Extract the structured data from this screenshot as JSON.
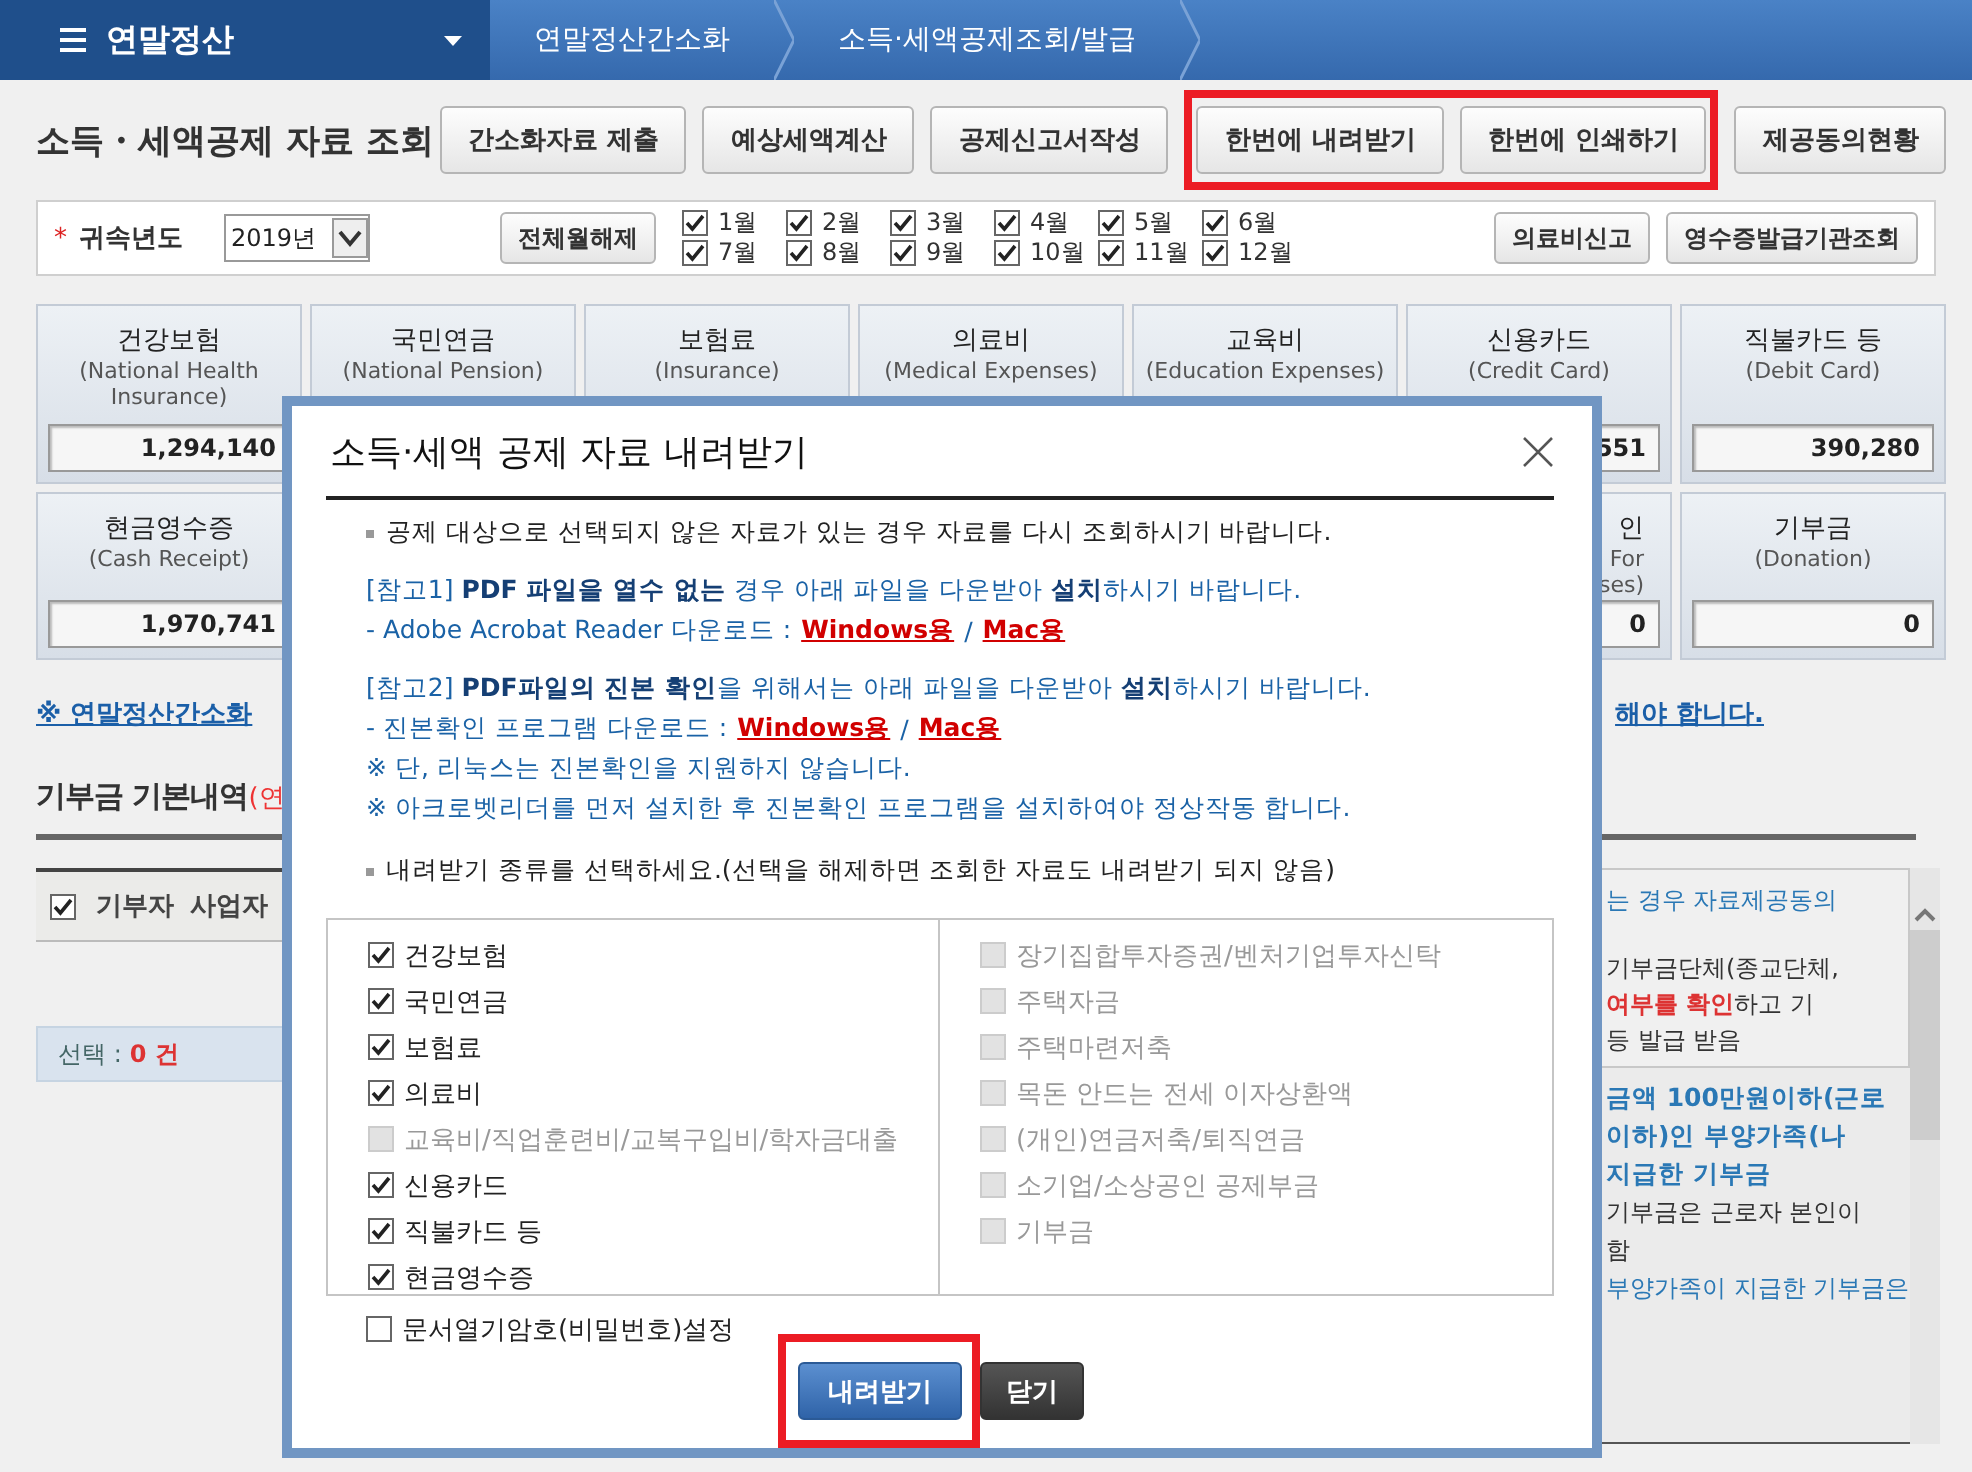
{
  "nav": {
    "menu_title": "연말정산",
    "breadcrumbs": [
      "연말정산간소화",
      "소득·세액공제조회/발급"
    ]
  },
  "page_title": "소득・세액공제 자료 조회",
  "toolbar": [
    {
      "label": "간소화자료 제출",
      "highlighted": false
    },
    {
      "label": "예상세액계산",
      "highlighted": false
    },
    {
      "label": "공제신고서작성",
      "highlighted": false
    },
    {
      "label": "한번에 내려받기",
      "highlighted": true
    },
    {
      "label": "한번에 인쇄하기",
      "highlighted": true
    },
    {
      "label": "제공동의현황",
      "highlighted": false
    }
  ],
  "filter": {
    "required_mark": "*",
    "year_label": "귀속년도",
    "year": "2019년",
    "toggle_all": "전체월해제",
    "months": [
      {
        "label": "1월",
        "checked": true
      },
      {
        "label": "2월",
        "checked": true
      },
      {
        "label": "3월",
        "checked": true
      },
      {
        "label": "4월",
        "checked": true
      },
      {
        "label": "5월",
        "checked": true
      },
      {
        "label": "6월",
        "checked": true
      },
      {
        "label": "7월",
        "checked": true
      },
      {
        "label": "8월",
        "checked": true
      },
      {
        "label": "9월",
        "checked": true
      },
      {
        "label": "10월",
        "checked": true
      },
      {
        "label": "11월",
        "checked": true
      },
      {
        "label": "12월",
        "checked": true
      }
    ],
    "buttons": [
      "의료비신고",
      "영수증발급기관조회"
    ]
  },
  "cards_row1": [
    {
      "title": "건강보험",
      "subtitle_lines": [
        "(National Health",
        "Insurance)"
      ],
      "value": "1,294,140"
    },
    {
      "title": "국민연금",
      "subtitle_lines": [
        "(National Pension)"
      ]
    },
    {
      "title": "보험료",
      "subtitle_lines": [
        "(Insurance)"
      ]
    },
    {
      "title": "의료비",
      "subtitle_lines": [
        "(Medical Expenses)"
      ]
    },
    {
      "title": "교육비",
      "subtitle_lines": [
        "(Education Expenses)"
      ]
    },
    {
      "title": "신용카드",
      "subtitle_lines": [
        "(Credit Card)"
      ],
      "value": "551"
    },
    {
      "title": "직불카드 등",
      "subtitle_lines": [
        "(Debit Card)"
      ],
      "value": "390,280"
    }
  ],
  "cards_row2": {
    "left": [
      {
        "title": "현금영수증",
        "subtitle_lines": [
          "(Cash Receipt)"
        ],
        "value": "1,970,741"
      }
    ],
    "right": [
      {
        "title": "인",
        "subtitle_lines": [
          "For",
          "ses)"
        ],
        "value": "0"
      },
      {
        "title": "기부금",
        "subtitle_lines": [
          "(Donation)"
        ],
        "value": "0"
      }
    ]
  },
  "notice": {
    "left": "※ 연말정산간소화",
    "right": "해야 합니다."
  },
  "donation": {
    "title": "기부금 기본내역",
    "title_note": "(연",
    "header_checked": true,
    "columns": [
      "기부자",
      "사업자"
    ],
    "selection_label": "선택 :",
    "selection_count": "0 건"
  },
  "info_panel": {
    "box_lines": [
      {
        "kind": "blue",
        "text": "는 경우 자료제공동의"
      },
      {
        "kind": "plain",
        "text": "기부금단체(종교단체,"
      },
      {
        "kind": "plain",
        "text": "**여부를 확인**하고 기"
      },
      {
        "kind": "plain",
        "text": "등 발급 받음"
      }
    ],
    "lines": [
      {
        "kind": "heading",
        "text": "금액 100만원이하(근로"
      },
      {
        "kind": "heading",
        "text": "이하)인 부양가족(나"
      },
      {
        "kind": "heading",
        "text": "지급한 기부금"
      },
      {
        "kind": "plain",
        "text": "기부금은 근로자 본인이"
      },
      {
        "kind": "plain",
        "text": "함"
      },
      {
        "kind": "blue",
        "text": "부양가족이 지급한 기부금은"
      }
    ]
  },
  "dialog": {
    "title": "소득·세액 공제 자료 내려받기",
    "intro": "공제 대상으로 선택되지 않은 자료가 있는 경우 자료를 다시 조회하시기 바랍니다.",
    "references": [
      {
        "text": "[참고1] **PDF 파일을 열수 없는** 경우  아래 파일을 다운받아 **설치**하시기 바랍니다.",
        "download_label": "- Adobe Acrobat Reader 다운로드 :",
        "links": [
          "Windows용",
          "Mac용"
        ],
        "separator": "/"
      },
      {
        "text": "[참고2] **PDF파일의 진본 확인**을 위해서는 아래 파일을 다운받아 **설치**하시기 바랍니다.",
        "download_label": "- 진본확인 프로그램 다운로드 :",
        "links": [
          "Windows용",
          "Mac용"
        ],
        "separator": "/",
        "notes": [
          "※ 단, 리눅스는 진본확인을 지원하지 않습니다.",
          "※ 아크로벳리더를 먼저 설치한 후 진본확인 프로그램을 설치하여야 정상작동 합니다."
        ]
      }
    ],
    "select_prompt": "내려받기 종류를 선택하세요.(선택을 해제하면 조회한 자료도 내려받기 되지 않음)",
    "left_options": [
      {
        "label": "건강보험",
        "checked": true,
        "disabled": false
      },
      {
        "label": "국민연금",
        "checked": true,
        "disabled": false
      },
      {
        "label": "보험료",
        "checked": true,
        "disabled": false
      },
      {
        "label": "의료비",
        "checked": true,
        "disabled": false
      },
      {
        "label": "교육비/직업훈련비/교복구입비/학자금대출",
        "checked": false,
        "disabled": true
      },
      {
        "label": "신용카드",
        "checked": true,
        "disabled": false
      },
      {
        "label": "직불카드 등",
        "checked": true,
        "disabled": false
      },
      {
        "label": "현금영수증",
        "checked": true,
        "disabled": false
      }
    ],
    "right_options": [
      {
        "label": "장기집합투자증권/벤처기업투자신탁",
        "checked": false,
        "disabled": true
      },
      {
        "label": "주택자금",
        "checked": false,
        "disabled": true
      },
      {
        "label": "주택마련저축",
        "checked": false,
        "disabled": true
      },
      {
        "label": "목돈 안드는 전세 이자상환액",
        "checked": false,
        "disabled": true
      },
      {
        "label": "(개인)연금저축/퇴직연금",
        "checked": false,
        "disabled": true
      },
      {
        "label": "소기업/소상공인 공제부금",
        "checked": false,
        "disabled": true
      },
      {
        "label": "기부금",
        "checked": false,
        "disabled": true
      }
    ],
    "password_option": {
      "label": "문서열기암호(비밀번호)설정",
      "checked": false
    },
    "buttons": [
      {
        "kind": "primary",
        "label": "내려받기",
        "highlighted": true
      },
      {
        "kind": "dark",
        "label": "닫기",
        "highlighted": false
      }
    ]
  }
}
